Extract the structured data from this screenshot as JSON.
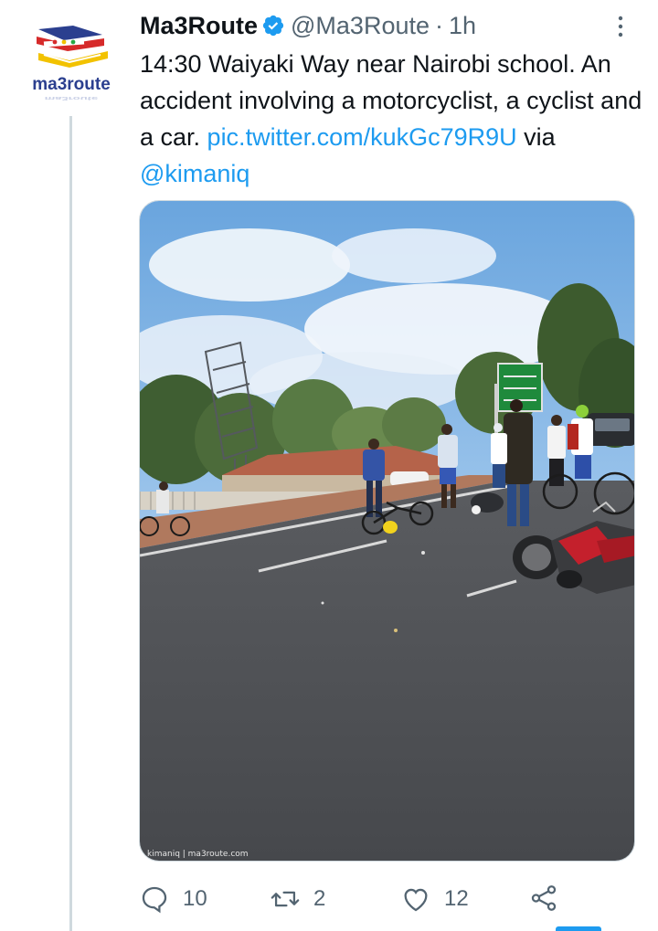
{
  "tweet": {
    "author_name": "Ma3Route",
    "handle": "@Ma3Route",
    "separator": "·",
    "time": "1h",
    "avatar_text": "ma3route",
    "text_main": "14:30 Waiyaki Way near Nairobi school. An accident involving a  motorcyclist, a cyclist and a car.  ",
    "link_pic": "pic.twitter.com/kukGc79R9U",
    "via_text": " via ",
    "mention": "@kimaniq"
  },
  "media": {
    "watermark": "kimaniq | ma3route.com",
    "description_icon": "photo"
  },
  "actions": {
    "reply_count": "10",
    "retweet_count": "2",
    "like_count": "12"
  },
  "colors": {
    "accent": "#1d9bf0",
    "secondary_text": "#536471",
    "text": "#0f1419",
    "divider": "#cfd9de"
  },
  "icons": [
    "verified-badge-icon",
    "more-options-icon",
    "reply-icon",
    "retweet-icon",
    "like-icon",
    "share-icon"
  ]
}
